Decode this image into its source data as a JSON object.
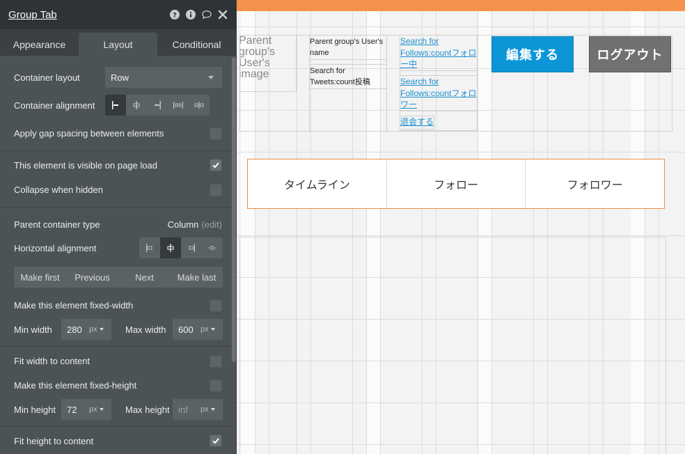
{
  "panel": {
    "title": "Group Tab",
    "tabs": [
      {
        "label": "Appearance"
      },
      {
        "label": "Layout"
      },
      {
        "label": "Conditional"
      }
    ],
    "container_layout": {
      "label": "Container layout",
      "value": "Row"
    },
    "container_alignment": {
      "label": "Container alignment"
    },
    "gap_spacing": {
      "label": "Apply gap spacing between elements",
      "checked": false
    },
    "visible_on_load": {
      "label": "This element is visible on page load",
      "checked": true
    },
    "collapse_hidden": {
      "label": "Collapse when hidden",
      "checked": false
    },
    "parent_container": {
      "label": "Parent container type",
      "value": "Column",
      "edit": "(edit)"
    },
    "horizontal_alignment": {
      "label": "Horizontal alignment"
    },
    "order": {
      "make_first": "Make first",
      "previous": "Previous",
      "next": "Next",
      "make_last": "Make last"
    },
    "fixed_width": {
      "label": "Make this element fixed-width",
      "checked": false
    },
    "min_width": {
      "label": "Min width",
      "value": "280",
      "unit": "px"
    },
    "max_width": {
      "label": "Max width",
      "value": "600",
      "unit": "px"
    },
    "fit_width": {
      "label": "Fit width to content",
      "checked": false
    },
    "fixed_height": {
      "label": "Make this element fixed-height",
      "checked": false
    },
    "min_height": {
      "label": "Min height",
      "value": "72",
      "unit": "px"
    },
    "max_height": {
      "label": "Max height",
      "placeholder": "inf",
      "unit": "px"
    },
    "fit_height": {
      "label": "Fit height to content",
      "checked": true
    }
  },
  "canvas": {
    "image_placeholder": "Parent group's User's image",
    "user_name": "Parent group's User's name",
    "tweets_count": "Search for Tweets:count投稿",
    "follows_count": "Search for Follows:countフォロー中",
    "followers_count": "Search for Follows:countフォロワー",
    "withdraw_link": "退会する",
    "edit_button": "編集する",
    "logout_button": "ログアウト",
    "tabs": [
      "タイムライン",
      "フォロー",
      "フォロワー"
    ]
  },
  "colors": {
    "accent_orange": "#f7924d",
    "edit_button_blue": "#0c96d8",
    "logout_button_gray": "#717171",
    "link_blue": "#1a8fd0"
  },
  "icons": [
    "help-icon",
    "info-icon",
    "comment-icon",
    "close-icon",
    "check-icon"
  ]
}
